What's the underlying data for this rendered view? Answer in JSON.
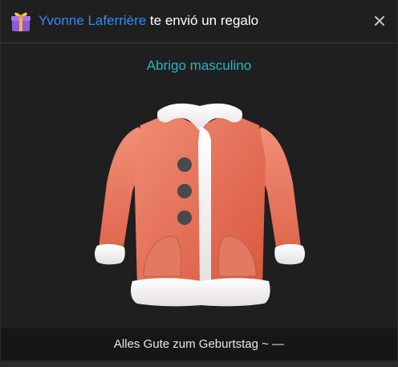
{
  "header": {
    "gift_icon": "gift-box-icon",
    "sender_name": "Yvonne Laferrière",
    "title_rest": " te envió un regalo",
    "close_icon": "close-icon"
  },
  "gift": {
    "item_name": "Abrigo masculino",
    "image_icon": "red-coat-illustration"
  },
  "footer": {
    "message": "Alles Gute zum Geburtstag ~ —"
  },
  "colors": {
    "accent_name": "#2f8bf0",
    "item_name": "#27b3c0",
    "background": "#1f1f20",
    "coat": "#e5735c"
  }
}
